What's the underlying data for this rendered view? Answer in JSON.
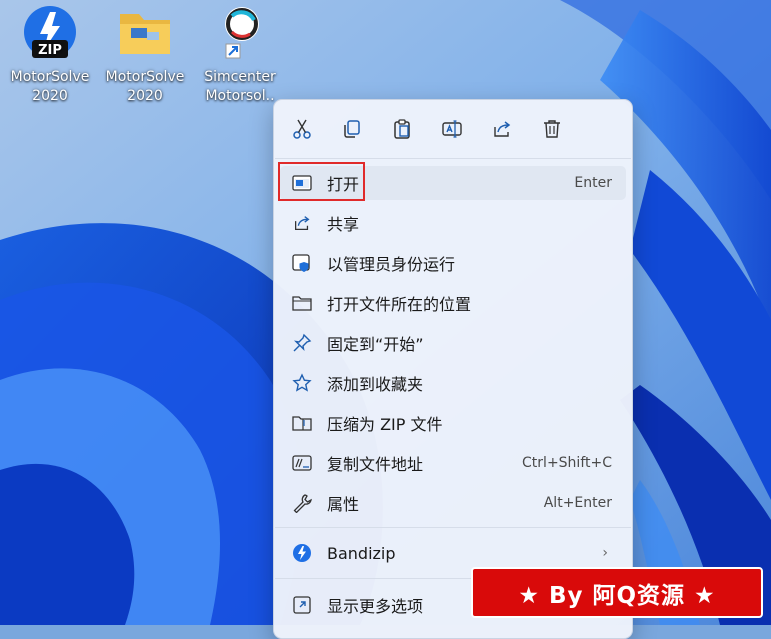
{
  "desktop": {
    "icons": [
      {
        "label": "MotorSolve\n2020",
        "badge": "ZIP",
        "icon": "zip-archive-icon"
      },
      {
        "label": "MotorSolve\n2020",
        "icon": "folder-icon"
      },
      {
        "label": "Simcenter\nMotorsol..",
        "icon": "simcenter-shortcut-icon"
      }
    ]
  },
  "context_menu": {
    "toolbar": [
      {
        "icon": "scissors-icon",
        "action": "cut"
      },
      {
        "icon": "copy-icon",
        "action": "copy"
      },
      {
        "icon": "paste-icon",
        "action": "paste"
      },
      {
        "icon": "rename-icon",
        "action": "rename"
      },
      {
        "icon": "share-icon",
        "action": "share"
      },
      {
        "icon": "trash-icon",
        "action": "delete"
      }
    ],
    "items": [
      {
        "label": "打开",
        "shortcut": "Enter",
        "icon": "open-window-icon"
      },
      {
        "label": "共享",
        "shortcut": "",
        "icon": "share-icon"
      },
      {
        "label": "以管理员身份运行",
        "shortcut": "",
        "icon": "admin-shield-icon"
      },
      {
        "label": "打开文件所在的位置",
        "shortcut": "",
        "icon": "folder-outline-icon"
      },
      {
        "label": "固定到“开始”",
        "shortcut": "",
        "icon": "pin-icon"
      },
      {
        "label": "添加到收藏夹",
        "shortcut": "",
        "icon": "star-icon"
      },
      {
        "label": "压缩为 ZIP 文件",
        "shortcut": "",
        "icon": "zip-folder-icon"
      },
      {
        "label": "复制文件地址",
        "shortcut": "Ctrl+Shift+C",
        "icon": "copy-path-icon"
      },
      {
        "label": "属性",
        "shortcut": "Alt+Enter",
        "icon": "wrench-icon"
      }
    ],
    "bandizip": {
      "label": "Bandizip",
      "icon": "bandizip-icon",
      "chevron": "›"
    },
    "more": {
      "label": "显示更多选项",
      "icon": "show-more-icon"
    }
  },
  "watermark": {
    "text": "★ By 阿Q资源 ★"
  },
  "colors": {
    "accent": "#0067c0",
    "highlight_border": "#e02a2a",
    "banner": "#d90a0a"
  }
}
